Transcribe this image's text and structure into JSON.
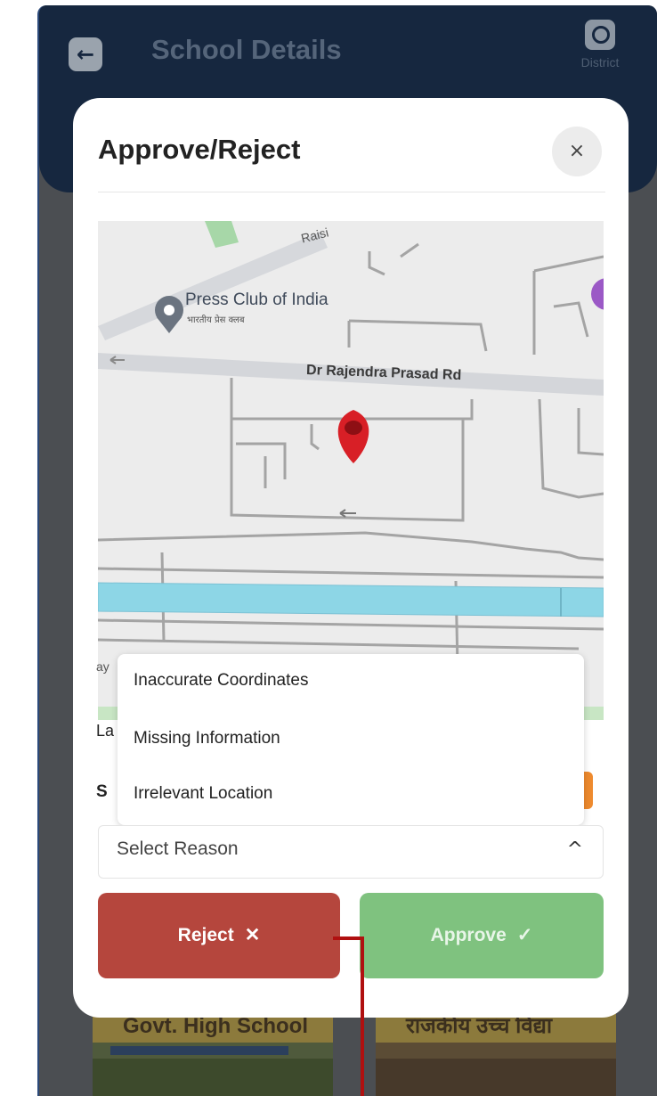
{
  "header": {
    "title": "School Details",
    "back_icon": "arrow-left-icon",
    "profile_label": "District",
    "profile_icon": "user-circle-icon"
  },
  "background_cards": {
    "card1_sign": "Govt. High School",
    "card2_sign": "राजकीय उच्च विद्या"
  },
  "modal": {
    "title": "Approve/Reject",
    "close_glyph": "×",
    "map": {
      "place_name": "Press Club of India",
      "place_name_hindi": "भारतीय प्रेस क्लब",
      "road_name": "Dr Rajendra Prasad Rd",
      "road_top": "Raisi",
      "marker_icon": "location-pin-icon"
    },
    "fragments": {
      "lat": "La",
      "select": "S",
      "ay": "ay"
    },
    "dropdown": {
      "options": [
        "Inaccurate Coordinates",
        "Missing Information",
        "Irrelevant Location"
      ]
    },
    "select": {
      "value": "Select Reason",
      "chevron": "^"
    },
    "buttons": {
      "reject_label": "Reject",
      "reject_glyph": "✕",
      "approve_label": "Approve",
      "approve_glyph": "✓"
    }
  },
  "colors": {
    "appbar": "#16273f",
    "reject": "#b5463d",
    "approve": "#7fc27f",
    "map_marker": "#d81f26",
    "water": "#8dd6e6",
    "pointer": "#b01010"
  }
}
